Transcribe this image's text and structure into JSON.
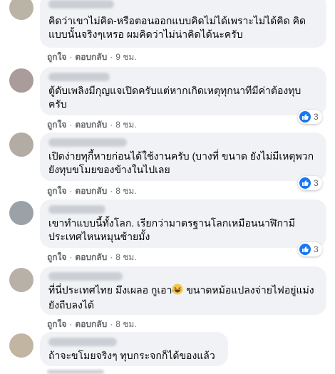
{
  "comments": [
    {
      "text": "คิดว่าเขาไม่คิด-หรือตอนออกแบบคิดไม่ได้เพราะไม่ได้คิด คิดแบบนั้นจริงๆเหรอ ผมคิดว่าไม่น่าคิดได้นะครับ",
      "like": "ถูกใจ",
      "reply": "ตอบกลับ",
      "time": "9 ชม."
    },
    {
      "text": "ตู้ดับเพลิงมีกุญแจเปิดครับแต่หากเกิดเหตุทุกนาทีมีค่าต้องทุบครับ",
      "like": "ถูกใจ",
      "reply": "ตอบกลับ",
      "time": "8 ชม.",
      "reactions": "3"
    },
    {
      "text": "เปิดง่ายทุกี้หายก่อนได้ใช้งานครับ (บางที่ ขนาด ยังไม่มีเหตุพวกยังทุบขโมยของข้างในไปเลย",
      "like": "ถูกใจ",
      "reply": "ตอบกลับ",
      "time": "8 ชม.",
      "reactions": "3"
    },
    {
      "text": "เขาทำแบบนี้ทั้งโลก. เรียกว่ามาตรฐานโลกเหมือนนาฬิกามีประเทศไหนหมุนซ้ายมั้ง",
      "like": "ถูกใจ",
      "reply": "ตอบกลับ",
      "time": "8 ชม.",
      "reactions": "3"
    },
    {
      "text_before": "ที่นี่ประเทศไทย มึงเผลอ กูเอา",
      "text_after": " ขนาดหม้อแปลงจ่ายไฟอยู่แม่งยังถีบลงได้",
      "like": "ถูกใจ",
      "reply": "ตอบกลับ",
      "time": "8 ชม."
    },
    {
      "text": "ถ้าจะขโมยจริงๆ ทุบกระจกก็ได้ของแล้ว"
    }
  ]
}
